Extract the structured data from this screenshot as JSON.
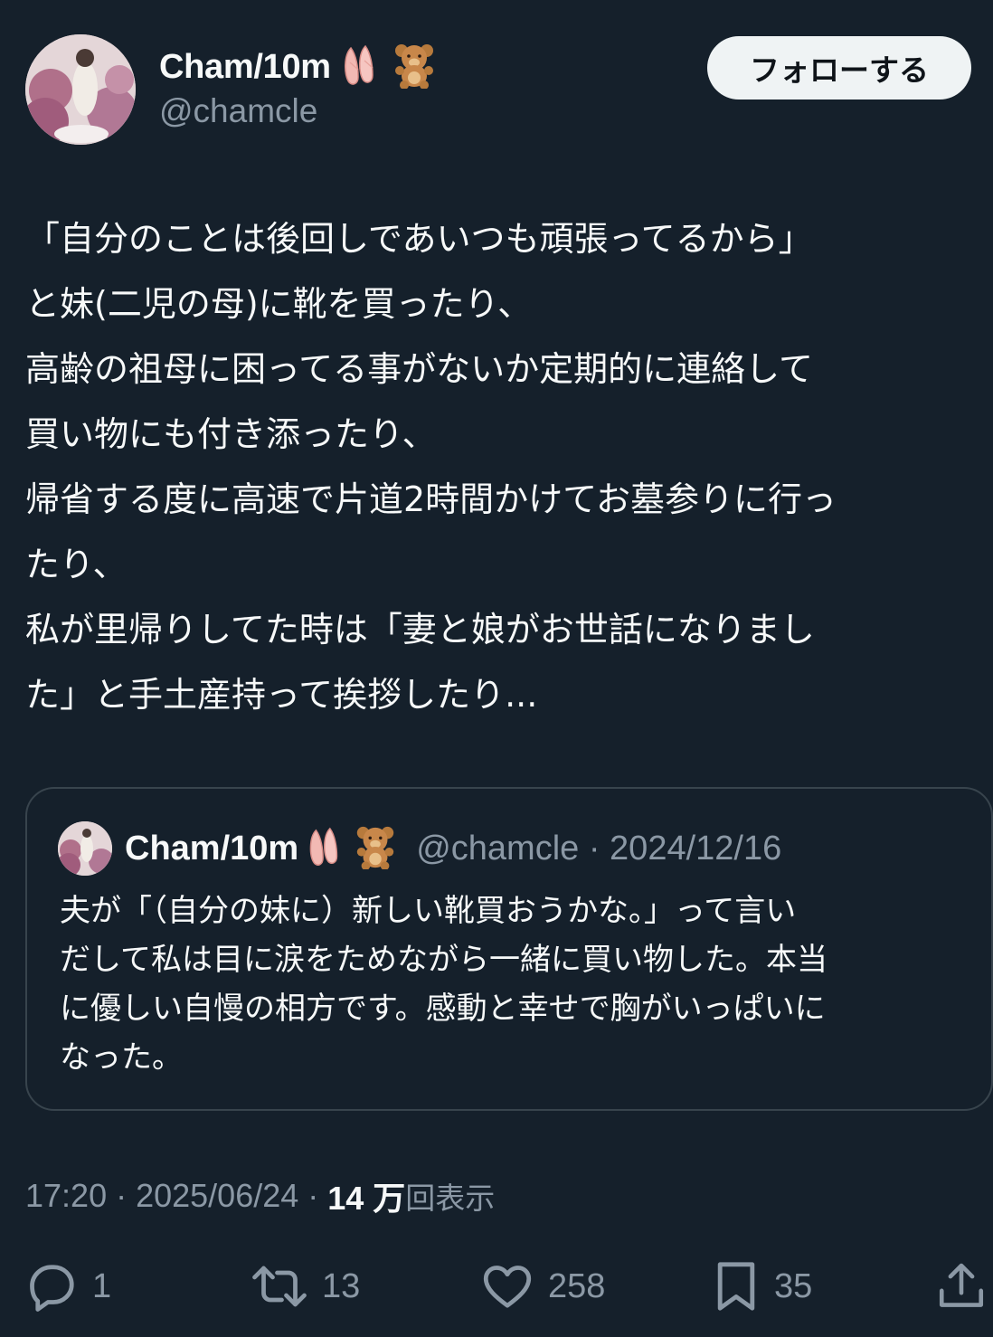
{
  "author": {
    "display_name": "Cham/10m",
    "emoji": "🩰🧸",
    "handle": "@chamcle"
  },
  "follow_button": {
    "label": "フォローする"
  },
  "tweet": {
    "lines": [
      "「自分のことは後回しであいつも頑張ってるから」",
      "と妹(二児の母)に靴を買ったり、",
      "高齢の祖母に困ってる事がないか定期的に連絡して",
      "買い物にも付き添ったり、",
      "帰省する度に高速で片道2時間かけてお墓参りに行っ",
      "たり、",
      "私が里帰りしてた時は「妻と娘がお世話になりまし",
      "た」と手土産持って挨拶したり..."
    ]
  },
  "quote": {
    "display_name": "Cham/10m",
    "emoji": "🩰🧸",
    "meta": "@chamcle · 2024/12/16",
    "lines": [
      "夫が「（自分の妹に）新しい靴買おうかな。」って言い",
      "だして私は目に涙をためながら一緒に買い物した。本当",
      "に優しい自慢の相方です。感動と幸せで胸がいっぱいに",
      "なった。"
    ]
  },
  "meta": {
    "time": "17:20 · 2025/06/24 · ",
    "views_count": "14 万",
    "views_label": "回表示"
  },
  "actions": {
    "replies": "1",
    "reposts": "13",
    "likes": "258",
    "bookmarks": "35"
  },
  "icons": {
    "reply": "reply-icon",
    "repost": "repost-icon",
    "like": "heart-icon",
    "bookmark": "bookmark-icon",
    "share": "share-icon"
  },
  "colors": {
    "background": "#15202b",
    "text_primary": "#f7f9f9",
    "text_secondary": "#8b98a5",
    "border": "#38444d",
    "follow_bg": "#eff3f4"
  }
}
